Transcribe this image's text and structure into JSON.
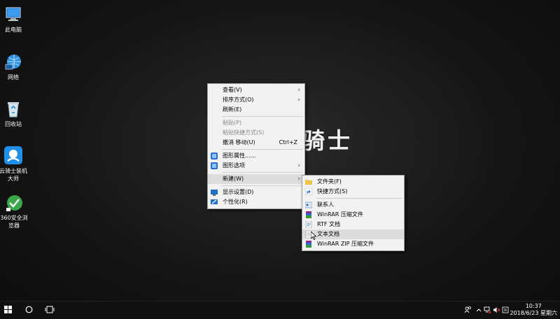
{
  "desktop_icons": [
    {
      "label": "此电脑",
      "icon": "computer-icon"
    },
    {
      "label": "网络",
      "icon": "network-icon"
    },
    {
      "label": "回收站",
      "icon": "recycle-bin-icon"
    },
    {
      "label": "云骑士装机大师",
      "icon": "yunqishi-icon"
    },
    {
      "label": "360安全浏览器",
      "icon": "browser-360-icon"
    }
  ],
  "wallpaper": {
    "text": "骑士"
  },
  "context_menu": {
    "items": {
      "view": "查看(V)",
      "sort": "排序方式(O)",
      "refresh": "刷新(E)",
      "paste": "粘贴(P)",
      "paste_shortcut": "粘贴快捷方式(S)",
      "undo_move": "撤消 移动(U)",
      "undo_shortcut": "Ctrl+Z",
      "graphics_props": "图形属性......",
      "graphics_options": "图形选项",
      "new": "新建(W)",
      "display": "显示设置(D)",
      "personalize": "个性化(R)"
    }
  },
  "new_submenu": {
    "items": {
      "folder": "文件夹(F)",
      "shortcut": "快捷方式(S)",
      "contact": "联系人",
      "winrar": "WinRAR 压缩文件",
      "rtf": "RTF 文档",
      "txt": "文本文档",
      "winrar_zip": "WinRAR ZIP 压缩文件"
    }
  },
  "taskbar": {
    "clock_time": "10:37",
    "clock_date": "2018/6/23 星期六"
  },
  "colors": {
    "menu_bg": "#f2f2f2",
    "taskbar_bg": "#101010",
    "hover": "#dcdcdc"
  }
}
